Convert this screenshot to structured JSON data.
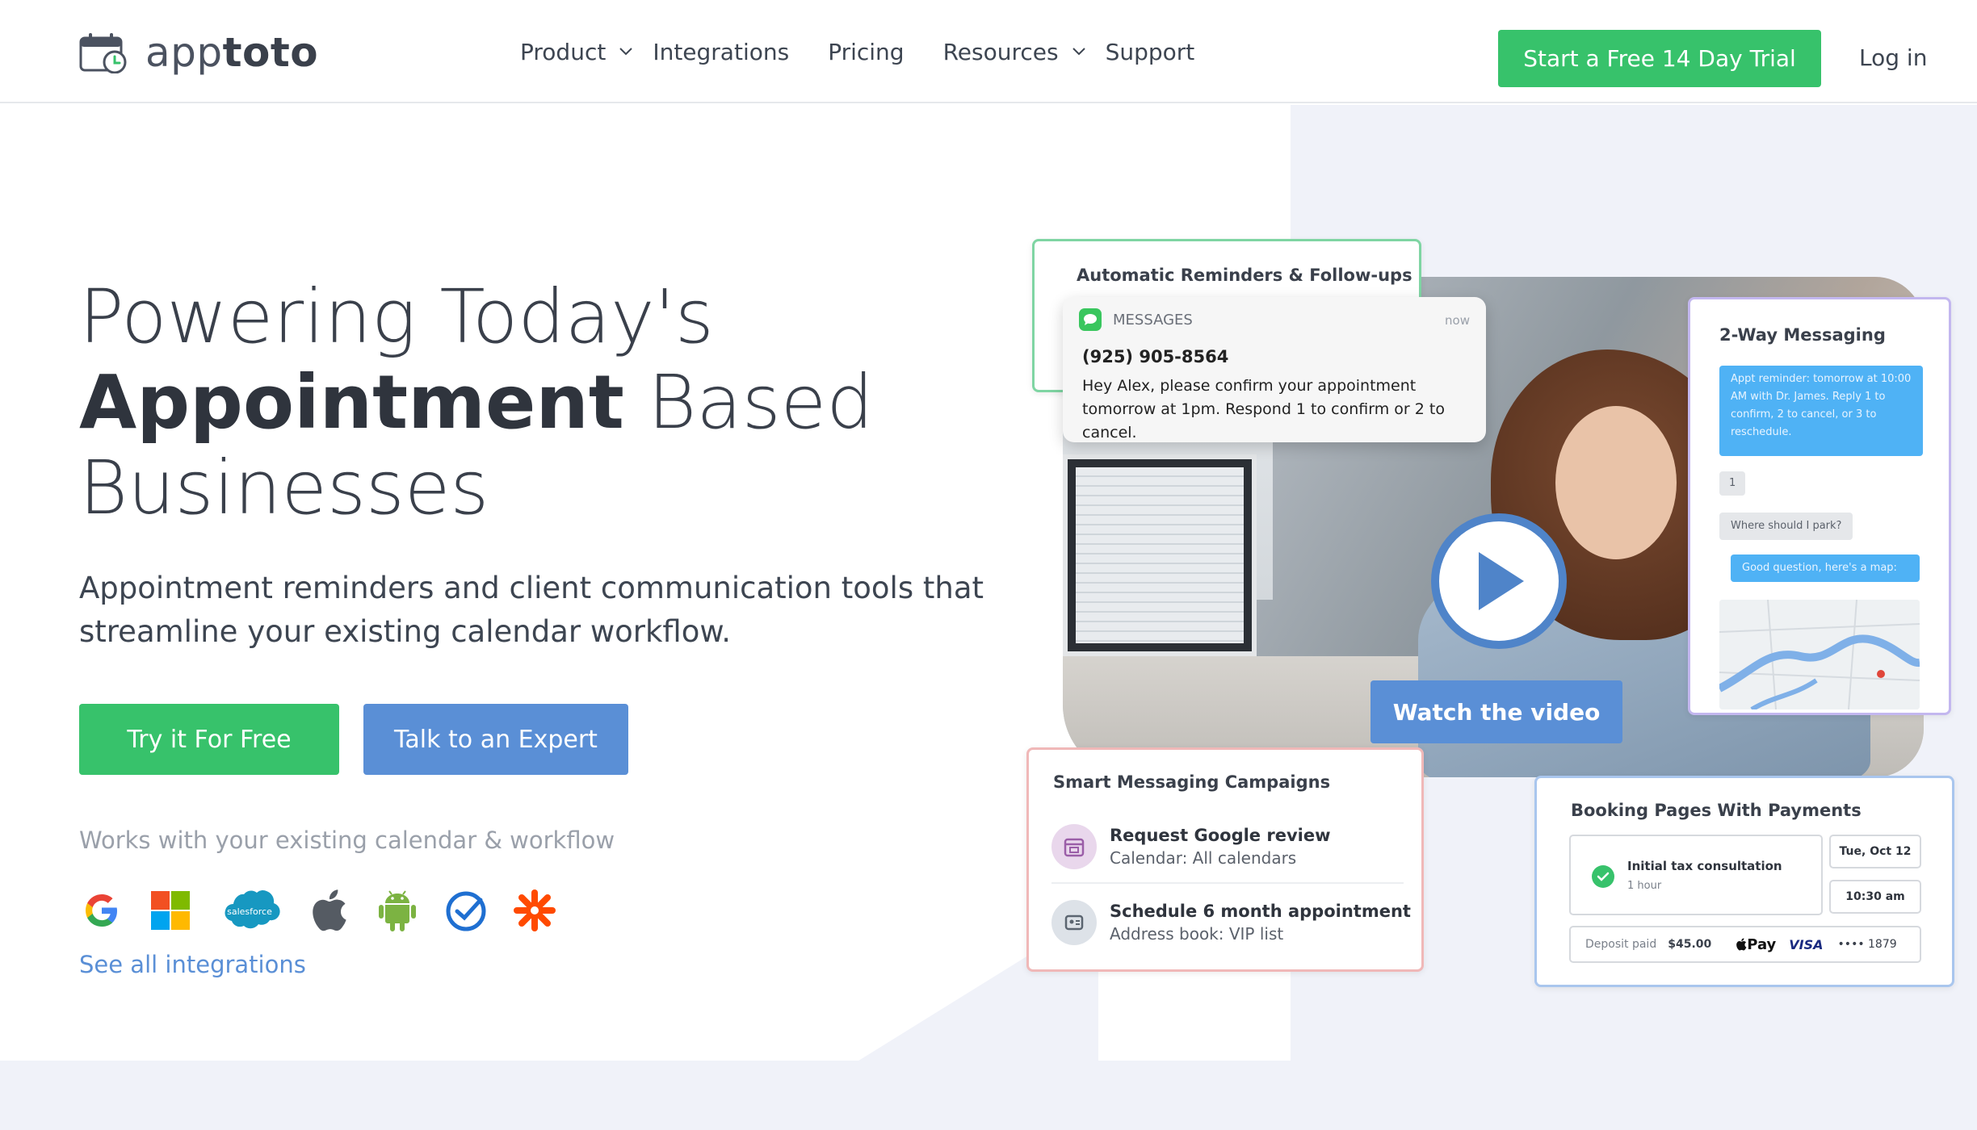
{
  "header": {
    "logo": {
      "prefix": "app",
      "suffix": "toto"
    },
    "nav": [
      {
        "label": "Product",
        "dropdown": true
      },
      {
        "label": "Integrations",
        "dropdown": false
      },
      {
        "label": "Pricing",
        "dropdown": false
      },
      {
        "label": "Resources",
        "dropdown": true
      },
      {
        "label": "Support",
        "dropdown": false
      }
    ],
    "trial_label": "Start a Free 14 Day Trial",
    "login_label": "Log in"
  },
  "hero": {
    "title_line1": "Powering Today's",
    "title_bold": "Appointment",
    "title_rest": " Based",
    "title_line3": "Businesses",
    "subtitle": "Appointment reminders and client communication tools that streamline your existing calendar workflow.",
    "try_label": "Try it For Free",
    "expert_label": "Talk to an Expert",
    "works_with": "Works with your existing calendar & workflow",
    "integration_icons": [
      "google-icon",
      "microsoft-icon",
      "salesforce-icon",
      "apple-icon",
      "android-icon",
      "checkmark-circle-icon",
      "zapier-icon"
    ],
    "salesforce_label": "salesforce",
    "see_all": "See all integrations"
  },
  "visual": {
    "reminders": {
      "title": "Automatic Reminders & Follow-ups",
      "app": "MESSAGES",
      "time": "now",
      "phone": "(925) 905-8564",
      "body": "Hey Alex, please confirm your appointment tomorrow at 1pm. Respond 1 to confirm or 2 to cancel."
    },
    "two_way": {
      "title": "2-Way Messaging",
      "msg1": "Appt reminder: tomorrow at 10:00 AM with Dr. James. Reply 1 to confirm, 2 to cancel, or 3 to reschedule.",
      "reply1": "1",
      "reply2": "Where should I park?",
      "msg2": "Good question, here's a map:"
    },
    "watch_label": "Watch the video",
    "smart": {
      "title": "Smart Messaging Campaigns",
      "item1_title": "Request Google review",
      "item1_sub": "Calendar: All calendars",
      "item2_title": "Schedule 6 month appointment",
      "item2_sub": "Address book: VIP list"
    },
    "booking": {
      "title": "Booking Pages With Payments",
      "consult_title": "Initial tax consultation",
      "consult_sub": "1 hour",
      "date": "Tue, Oct 12",
      "time": "10:30 am",
      "deposit_label": "Deposit paid",
      "deposit_amount": "$45.00",
      "apple_pay": "Pay",
      "visa": "VISA",
      "card_last4": "•••• 1879"
    }
  },
  "colors": {
    "green": "#37c26b",
    "blue": "#5a8fd6",
    "text": "#3d4551",
    "muted": "#9aa0aa",
    "panel_bg": "#f0f2f9"
  }
}
